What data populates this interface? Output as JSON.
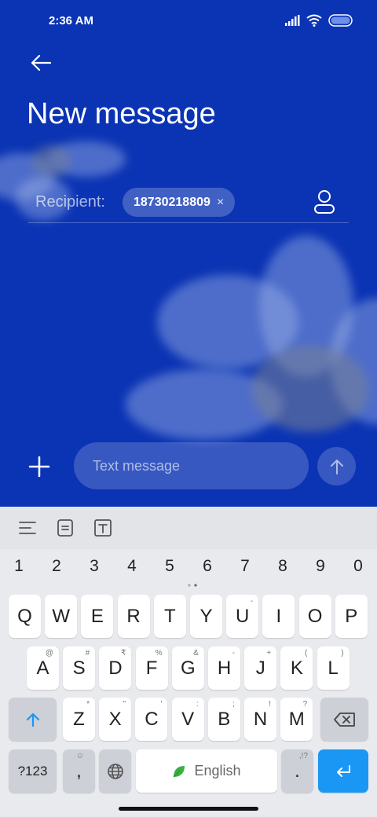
{
  "status_bar": {
    "time": "2:36 AM"
  },
  "header": {
    "title": "New message"
  },
  "recipient": {
    "label": "Recipient:",
    "chip": "18730218809",
    "chip_remove": "×"
  },
  "compose": {
    "placeholder": "Text message"
  },
  "keyboard": {
    "numbers": [
      "1",
      "2",
      "3",
      "4",
      "5",
      "6",
      "7",
      "8",
      "9",
      "0"
    ],
    "row1": [
      "Q",
      "W",
      "E",
      "R",
      "T",
      "Y",
      "U",
      "I",
      "O",
      "P"
    ],
    "row2": [
      {
        "k": "A",
        "s": "@"
      },
      {
        "k": "S",
        "s": "#"
      },
      {
        "k": "D",
        "s": "₹"
      },
      {
        "k": "F",
        "s": "%"
      },
      {
        "k": "G",
        "s": "&"
      },
      {
        "k": "H",
        "s": "-"
      },
      {
        "k": "J",
        "s": "+"
      },
      {
        "k": "K",
        "s": "("
      },
      {
        "k": "L",
        "s": ")"
      }
    ],
    "row3": [
      {
        "k": "Z",
        "s": "*"
      },
      {
        "k": "X",
        "s": "\""
      },
      {
        "k": "C",
        "s": "'"
      },
      {
        "k": "V",
        "s": ":"
      },
      {
        "k": "B",
        "s": ";"
      },
      {
        "k": "N",
        "s": "!"
      },
      {
        "k": "M",
        "s": "?"
      }
    ],
    "row1_sups": [
      "",
      "",
      "",
      "",
      "",
      "",
      "-",
      "",
      "",
      ""
    ],
    "symbols_key": "?123",
    "comma_key": ",",
    "space_label": "English",
    "period_key": ".",
    "period_sup": ",!?"
  },
  "colors": {
    "accent": "#0b34b4",
    "enter": "#1a97f5"
  }
}
